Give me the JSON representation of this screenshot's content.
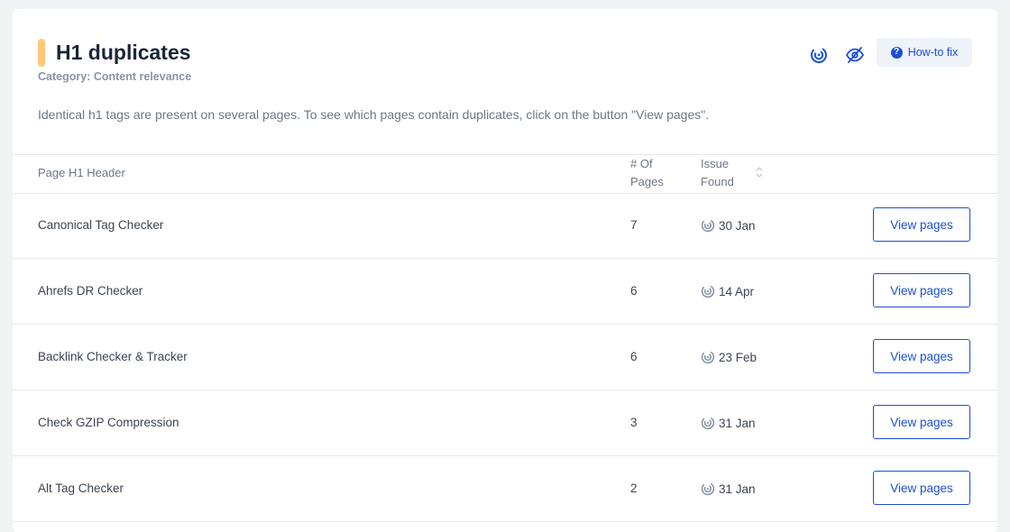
{
  "header": {
    "title": "H1 duplicates",
    "category": "Category: Content relevance",
    "description": "Identical h1 tags are present on several pages. To see which pages contain duplicates, click on the button \"View pages\".",
    "howto_label": "How-to fix",
    "icons": [
      "radar-icon",
      "eye-off-icon",
      "question-circle-icon"
    ]
  },
  "table": {
    "columns": {
      "header": "Page H1 Header",
      "pages_line1": "# Of",
      "pages_line2": "Pages",
      "issue_line1": "Issue",
      "issue_line2": "Found"
    },
    "rows": [
      {
        "header": "Canonical Tag Checker",
        "pages": "7",
        "found": "30 Jan",
        "action": "View pages"
      },
      {
        "header": "Ahrefs DR Checker",
        "pages": "6",
        "found": "14 Apr",
        "action": "View pages"
      },
      {
        "header": "Backlink Checker & Tracker",
        "pages": "6",
        "found": "23 Feb",
        "action": "View pages"
      },
      {
        "header": "Check GZIP Compression",
        "pages": "3",
        "found": "31 Jan",
        "action": "View pages"
      },
      {
        "header": "Alt Tag Checker",
        "pages": "2",
        "found": "31 Jan",
        "action": "View pages"
      }
    ]
  },
  "colors": {
    "accent": "#1a4fd6",
    "title_marker": "#ffc87a",
    "background": "#f2f3f5"
  }
}
